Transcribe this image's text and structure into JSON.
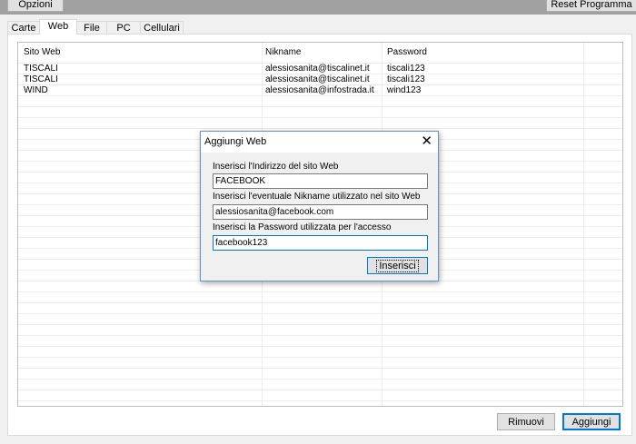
{
  "toolbar": {
    "options_label": "Opzioni",
    "reset_label": "Reset Programma"
  },
  "tabs": [
    {
      "label": "Carte"
    },
    {
      "label": "Web"
    },
    {
      "label": "File"
    },
    {
      "label": "PC"
    },
    {
      "label": "Cellulari"
    }
  ],
  "table": {
    "headers": [
      "Sito Web",
      "Nikname",
      "Password"
    ],
    "rows": [
      [
        "TISCALI",
        "alessiosanita@tiscalinet.it",
        "tiscali123"
      ],
      [
        "TISCALI",
        "alessiosanita@tiscalinet.it",
        "tiscali123"
      ],
      [
        "WIND",
        "alessiosanita@infostrada.it",
        "wind123"
      ]
    ]
  },
  "buttons": {
    "remove_label": "Rimuovi",
    "add_label": "Aggiungi"
  },
  "dialog": {
    "title": "Aggiungi Web",
    "close_glyph": "✕",
    "site_label": "Inserisci l'Indirizzo del sito Web",
    "site_value": "FACEBOOK",
    "nick_label": "Inserisci l'eventuale Nikname utilizzato nel sito Web",
    "nick_value": "alessiosanita@facebook.com",
    "password_label": "Inserisci la Password utilizzata per l'accesso",
    "password_value": "facebook123",
    "submit_label": "Inserisci"
  }
}
